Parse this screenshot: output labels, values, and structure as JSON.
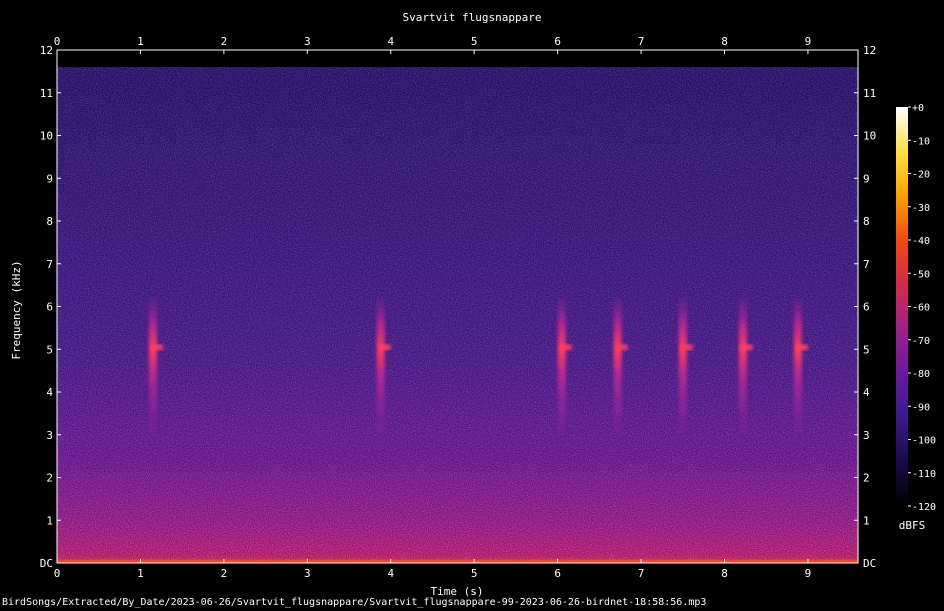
{
  "chart_data": {
    "type": "heatmap",
    "title": "Svartvit flugsnappare",
    "xlabel": "Time (s)",
    "ylabel": "Frequency (kHz)",
    "xlim": [
      0,
      9.6
    ],
    "ylim": [
      0,
      12
    ],
    "x_ticks": [
      "0",
      "1",
      "2",
      "3",
      "4",
      "5",
      "6",
      "7",
      "8",
      "9"
    ],
    "y_ticks": [
      "DC",
      "1",
      "2",
      "3",
      "4",
      "5",
      "6",
      "7",
      "8",
      "9",
      "10",
      "11",
      "12"
    ],
    "colorbar": {
      "label": "dBFS",
      "range": [
        -120,
        0
      ],
      "ticks": [
        "+0",
        "-10",
        "-20",
        "-30",
        "-40",
        "-50",
        "-60",
        "-70",
        "-80",
        "-90",
        "-100",
        "-110",
        "-120"
      ],
      "colors": [
        "#000000",
        "#1a0a4a",
        "#3a1a8a",
        "#6a1aa0",
        "#a0208a",
        "#d02a4a",
        "#f04a10",
        "#ffa000",
        "#ffe040",
        "#ffffff"
      ]
    },
    "calls_time_s": [
      1.15,
      3.88,
      6.05,
      6.72,
      7.5,
      8.22,
      8.88
    ],
    "call_freq_khz": [
      3.0,
      6.2
    ],
    "call_peak_khz": 5.0
  },
  "footer": {
    "path": "BirdSongs/Extracted/By_Date/2023-06-26/Svartvit_flugsnappare/Svartvit_flugsnappare-99-2023-06-26-birdnet-18:58:56.mp3"
  }
}
